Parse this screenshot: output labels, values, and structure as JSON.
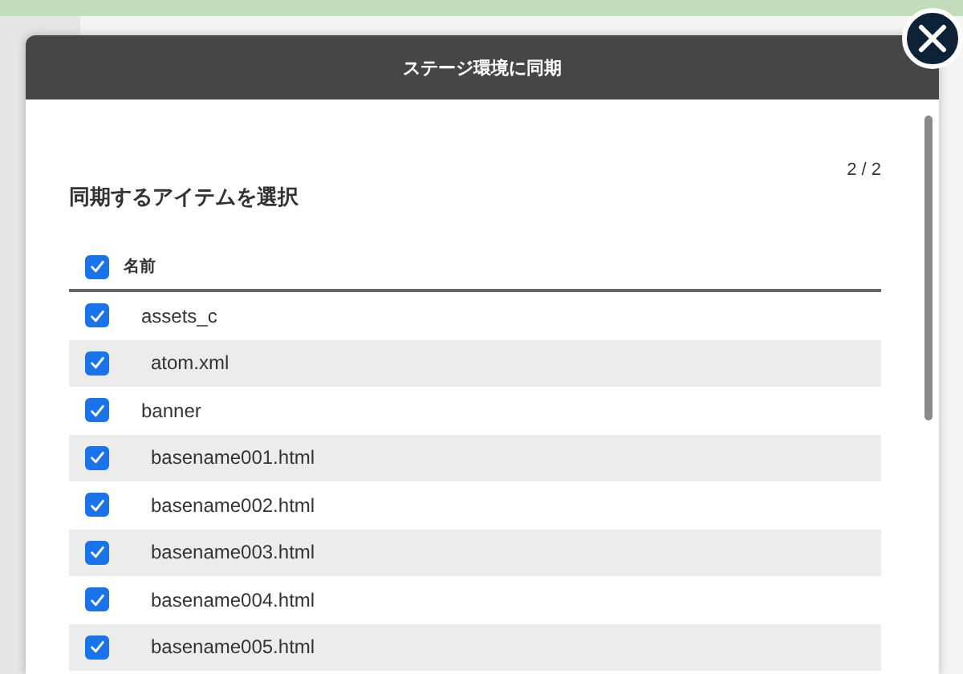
{
  "dialog": {
    "title": "ステージ環境に同期",
    "page_indicator": "2 / 2",
    "heading": "同期するアイテムを選択"
  },
  "table": {
    "select_all_checked": true,
    "columns": [
      "名前"
    ],
    "rows": [
      {
        "name": "assets_c",
        "checked": true,
        "children": [
          {
            "name": "atom.xml",
            "checked": true
          }
        ]
      },
      {
        "name": "banner",
        "checked": true,
        "children": [
          {
            "name": "basename001.html",
            "checked": true
          },
          {
            "name": "basename002.html",
            "checked": true
          },
          {
            "name": "basename003.html",
            "checked": true
          },
          {
            "name": "basename004.html",
            "checked": true
          },
          {
            "name": "basename005.html",
            "checked": true
          }
        ]
      }
    ]
  }
}
